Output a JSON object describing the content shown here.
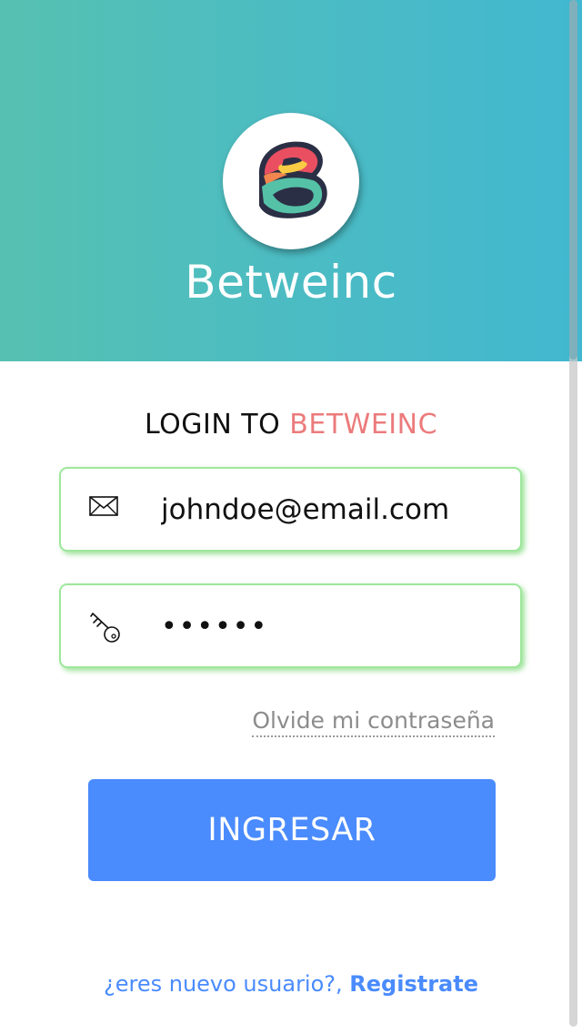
{
  "header": {
    "brand_name": "Betweinc",
    "logo": "brand-b-logo",
    "gradient_colors": [
      "#56c1b1",
      "#42b8d0"
    ]
  },
  "login": {
    "heading_prefix": "LOGIN TO",
    "heading_brand": "BETWEINC",
    "accent_color": "#ec7b7c"
  },
  "form": {
    "email": {
      "icon": "envelope-icon",
      "value": "johndoe@email.com"
    },
    "password": {
      "icon": "key-icon",
      "value": "••••••"
    },
    "field_border_color": "#9ee79c",
    "forgot_password_label": "Olvide mi contraseña",
    "submit_label": "INGRESAR",
    "submit_color": "#4a8bfd"
  },
  "footer": {
    "prompt": "¿eres nuevo usuario?,",
    "register_label": "Registrate"
  }
}
